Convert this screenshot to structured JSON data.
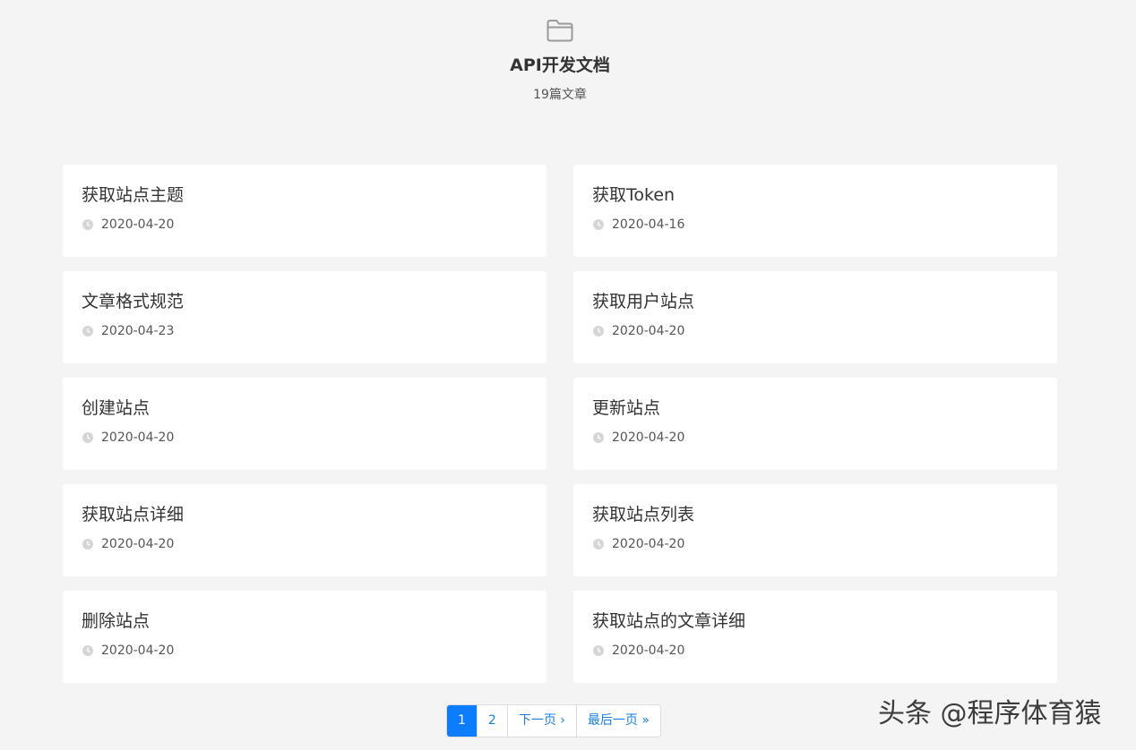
{
  "header": {
    "icon": "folder-icon",
    "title": "API开发文档",
    "article_count": "19篇文章"
  },
  "articles": [
    {
      "title": "获取站点主题",
      "date": "2020-04-20"
    },
    {
      "title": "获取Token",
      "date": "2020-04-16"
    },
    {
      "title": "文章格式规范",
      "date": "2020-04-23"
    },
    {
      "title": "获取用户站点",
      "date": "2020-04-20"
    },
    {
      "title": "创建站点",
      "date": "2020-04-20"
    },
    {
      "title": "更新站点",
      "date": "2020-04-20"
    },
    {
      "title": "获取站点详细",
      "date": "2020-04-20"
    },
    {
      "title": "获取站点列表",
      "date": "2020-04-20"
    },
    {
      "title": "删除站点",
      "date": "2020-04-20"
    },
    {
      "title": "获取站点的文章详细",
      "date": "2020-04-20"
    }
  ],
  "pagination": {
    "page_1": "1",
    "page_2": "2",
    "next": "下一页 ›",
    "last": "最后一页 »"
  },
  "watermark": "头条 @程序体育猿",
  "colors": {
    "background": "#f4f4f4",
    "card": "#ffffff",
    "accent": "#0d7dff",
    "link": "#1a7fe0"
  }
}
